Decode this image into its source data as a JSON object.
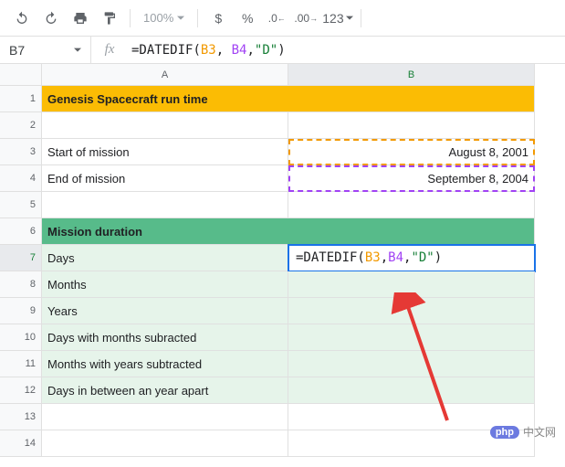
{
  "toolbar": {
    "zoom": "100%",
    "currency": "$",
    "percent": "%",
    "dec_dec": ".0",
    "dec_inc": ".00",
    "more_fmt": "123"
  },
  "formula_bar": {
    "cell_ref": "B7",
    "fn": "=DATEDIF",
    "open": "(",
    "ref1": "B3",
    "sep1": ", ",
    "ref2": "B4",
    "sep2": ",",
    "str": "\"D\"",
    "close": ")"
  },
  "headers": {
    "colA": "A",
    "colB": "B"
  },
  "rows": {
    "r1a": "Genesis Spacecraft run time",
    "r3a": "Start of mission",
    "r3b": "August 8, 2001",
    "r4a": "End of mission",
    "r4b": "September 8, 2004",
    "r6a": "Mission duration",
    "r7a": "Days",
    "r8a": "Months",
    "r9a": "Years",
    "r10a": "Days with months subracted",
    "r11a": "Months with years subtracted",
    "r12a": "Days in between an year apart"
  },
  "rownums": [
    "1",
    "2",
    "3",
    "4",
    "5",
    "6",
    "7",
    "8",
    "9",
    "10",
    "11",
    "12",
    "13",
    "14"
  ],
  "active_formula": {
    "prefix": "=DATEDIF(",
    "ref1": "B3",
    "sep1": ", ",
    "ref2": "B4",
    "sep2": ",",
    "str": "\"D\"",
    "close": ")"
  },
  "help": "?",
  "watermark": {
    "badge": "php",
    "text": "中文网"
  }
}
